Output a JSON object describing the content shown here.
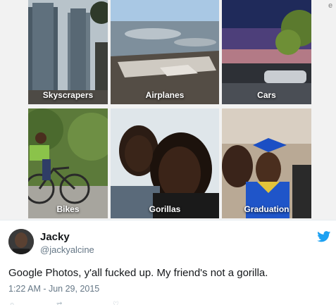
{
  "photo_grid": {
    "tiles": [
      {
        "label": "Skyscrapers"
      },
      {
        "label": "Airplanes"
      },
      {
        "label": "Cars"
      },
      {
        "label": "Bikes"
      },
      {
        "label": "Gorillas"
      },
      {
        "label": "Graduation"
      }
    ],
    "corner_icon": "e"
  },
  "tweet": {
    "author_name": "Jacky",
    "author_handle": "@jackyalcine",
    "text": "Google Photos, y'all fucked up. My friend's not a gorilla.",
    "timestamp": "1:22 AM - Jun 29, 2015",
    "brand_color": "#1da1f2",
    "icon": "twitter-bird-icon"
  }
}
